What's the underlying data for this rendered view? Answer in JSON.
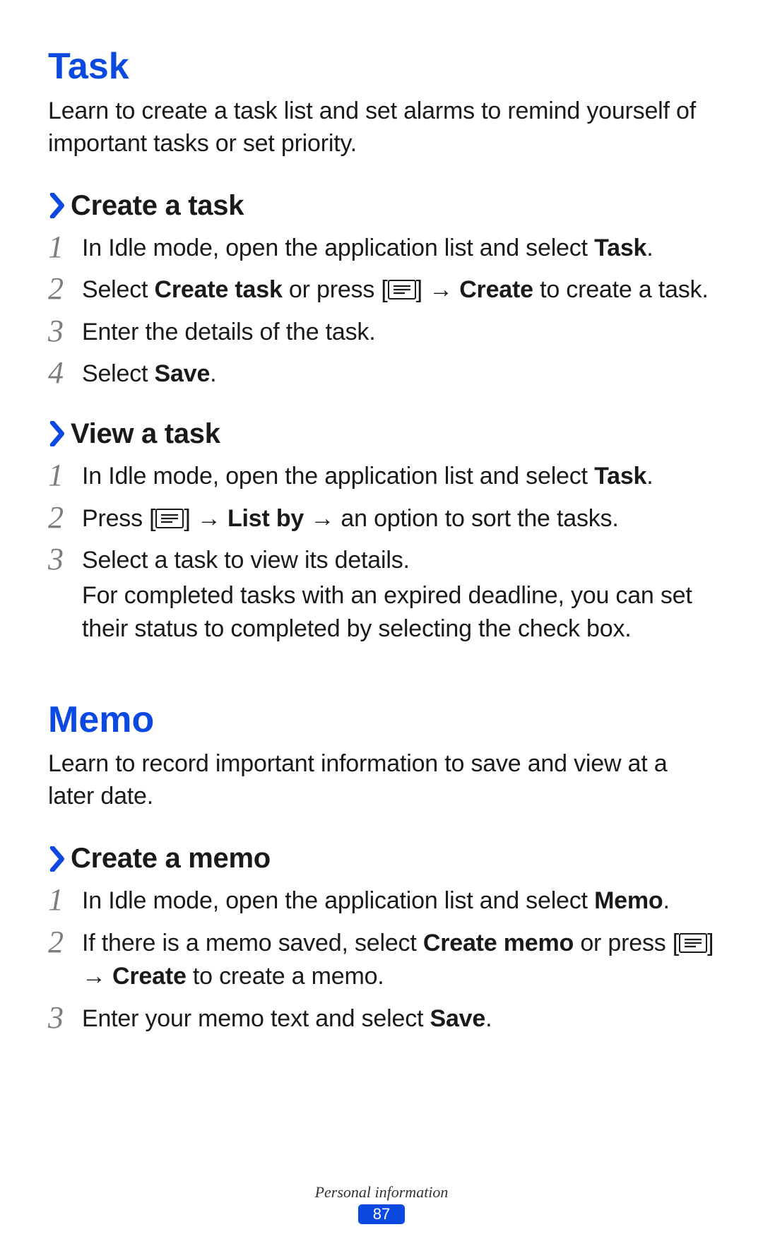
{
  "footer": {
    "section": "Personal information",
    "page": "87"
  },
  "task": {
    "title": "Task",
    "intro": "Learn to create a task list and set alarms to remind yourself of important tasks or set priority.",
    "create": {
      "heading": "Create a task",
      "s1_a": "In Idle mode, open the application list and select ",
      "s1_b": "Task",
      "s1_c": ".",
      "s2_a": "Select ",
      "s2_b": "Create task",
      "s2_c": " or press [",
      "s2_d": "] → ",
      "s2_e": "Create",
      "s2_f": " to create a task.",
      "s3": "Enter the details of the task.",
      "s4_a": "Select ",
      "s4_b": "Save",
      "s4_c": "."
    },
    "view": {
      "heading": "View a task",
      "s1_a": "In Idle mode, open the application list and select ",
      "s1_b": "Task",
      "s1_c": ".",
      "s2_a": "Press [",
      "s2_b": "] → ",
      "s2_c": "List by",
      "s2_d": " → an option to sort the tasks.",
      "s3": "Select a task to view its details.",
      "s3_note": "For completed tasks with an expired deadline, you can set their status to completed by selecting the check box."
    }
  },
  "memo": {
    "title": "Memo",
    "intro": "Learn to record important information to save and view at a later date.",
    "create": {
      "heading": "Create a memo",
      "s1_a": "In Idle mode, open the application list and select ",
      "s1_b": "Memo",
      "s1_c": ".",
      "s2_a": "If there is a memo saved, select ",
      "s2_b": "Create memo",
      "s2_c": " or press [",
      "s2_d": "] → ",
      "s2_e": "Create",
      "s2_f": " to create a memo.",
      "s3_a": "Enter your memo text and select ",
      "s3_b": "Save",
      "s3_c": "."
    }
  },
  "nums": {
    "1": "1",
    "2": "2",
    "3": "3",
    "4": "4"
  }
}
